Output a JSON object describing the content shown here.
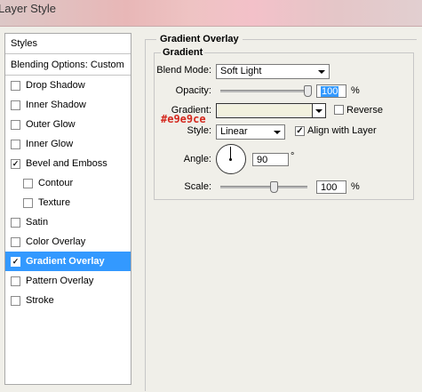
{
  "window": {
    "title": "Layer Style"
  },
  "sidebar": {
    "header": "Styles",
    "blending": "Blending Options: Custom",
    "items": [
      {
        "label": "Drop Shadow",
        "checked": false
      },
      {
        "label": "Inner Shadow",
        "checked": false
      },
      {
        "label": "Outer Glow",
        "checked": false
      },
      {
        "label": "Inner Glow",
        "checked": false
      },
      {
        "label": "Bevel and Emboss",
        "checked": true
      },
      {
        "label": "Contour",
        "checked": false,
        "sub": true
      },
      {
        "label": "Texture",
        "checked": false,
        "sub": true
      },
      {
        "label": "Satin",
        "checked": false
      },
      {
        "label": "Color Overlay",
        "checked": false
      },
      {
        "label": "Gradient Overlay",
        "checked": true,
        "selected": true
      },
      {
        "label": "Pattern Overlay",
        "checked": false
      },
      {
        "label": "Stroke",
        "checked": false
      }
    ]
  },
  "panel": {
    "section_title": "Gradient Overlay",
    "group_title": "Gradient",
    "blend_mode_label": "Blend Mode:",
    "blend_mode_value": "Soft Light",
    "opacity_label": "Opacity:",
    "opacity_value": "100",
    "opacity_unit": "%",
    "opacity_level": 1.0,
    "gradient_label": "Gradient:",
    "gradient_color": "#f2f1de",
    "gradient_annotation": "#e9e9ce",
    "reverse_label": "Reverse",
    "reverse_checked": false,
    "style_label": "Style:",
    "style_value": "Linear",
    "align_label": "Align with Layer",
    "align_checked": true,
    "angle_label": "Angle:",
    "angle_value": "90",
    "angle_unit": "°",
    "scale_label": "Scale:",
    "scale_value": "100",
    "scale_unit": "%",
    "scale_level": 0.6
  },
  "colors": {
    "selection": "#3399ff",
    "annotation": "#d4281e"
  }
}
